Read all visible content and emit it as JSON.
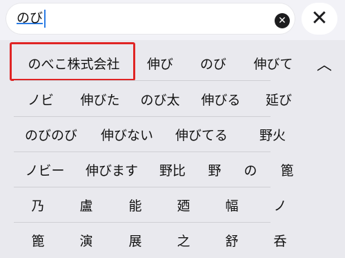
{
  "search": {
    "value": "のび",
    "clear_icon": "x-circle-icon",
    "close_icon": "close-icon"
  },
  "candidates": {
    "rows": [
      [
        "のべこ株式会社",
        "伸び",
        "のび",
        "伸びて"
      ],
      [
        "ノビ",
        "伸びた",
        "のび太",
        "伸びる",
        "延び"
      ],
      [
        "のびのび",
        "伸びない",
        "伸びてる",
        "野火"
      ],
      [
        "ノビー",
        "伸びます",
        "野比",
        "野",
        "の",
        "篦"
      ],
      [
        "乃",
        "盧",
        "能",
        "廼",
        "幅",
        "ノ"
      ],
      [
        "篦",
        "演",
        "展",
        "之",
        "舒",
        "呑"
      ]
    ],
    "collapse_symbol": "︿"
  }
}
